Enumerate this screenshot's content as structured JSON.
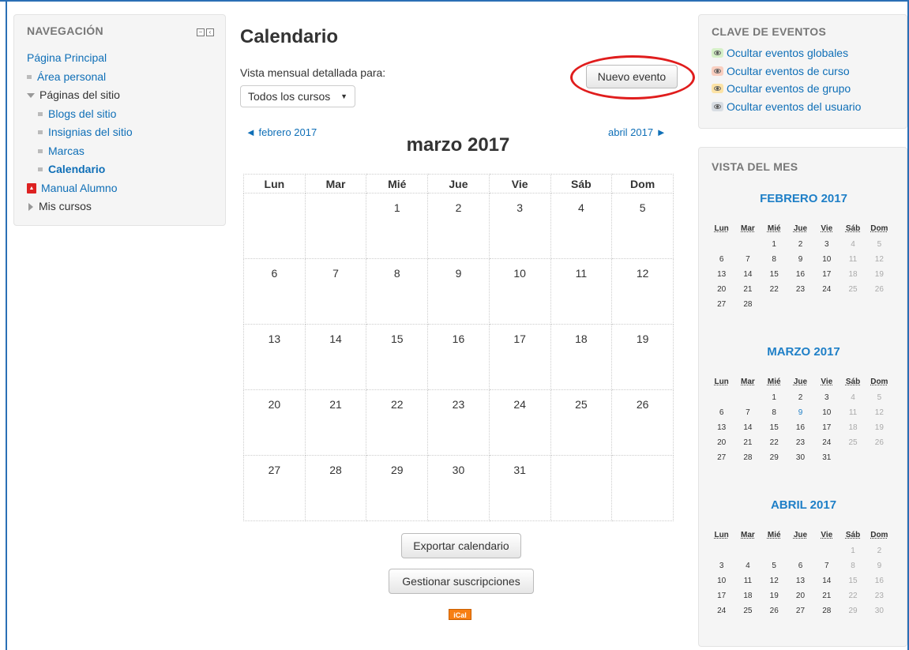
{
  "nav": {
    "title": "NAVEGACIÓN",
    "home": "Página Principal",
    "personal": "Área personal",
    "site_pages": "Páginas del sitio",
    "blogs": "Blogs del sitio",
    "badges": "Insignias del sitio",
    "tags": "Marcas",
    "calendar": "Calendario",
    "manual": "Manual Alumno",
    "my_courses": "Mis cursos"
  },
  "main": {
    "title": "Calendario",
    "view_label": "Vista mensual detallada para:",
    "course_select": "Todos los cursos",
    "new_event": "Nuevo evento",
    "prev_month": "◄ febrero 2017",
    "next_month": "abril 2017 ►",
    "month_title": "marzo 2017",
    "weekdays": [
      "Lun",
      "Mar",
      "Mié",
      "Jue",
      "Vie",
      "Sáb",
      "Dom"
    ],
    "weeks": [
      [
        "",
        "",
        "1",
        "2",
        "3",
        "4",
        "5"
      ],
      [
        "6",
        "7",
        "8",
        "9",
        "10",
        "11",
        "12"
      ],
      [
        "13",
        "14",
        "15",
        "16",
        "17",
        "18",
        "19"
      ],
      [
        "20",
        "21",
        "22",
        "23",
        "24",
        "25",
        "26"
      ],
      [
        "27",
        "28",
        "29",
        "30",
        "31",
        "",
        ""
      ]
    ],
    "export": "Exportar calendario",
    "subscriptions": "Gestionar suscripciones",
    "ical": "iCal"
  },
  "event_key": {
    "title": "CLAVE DE EVENTOS",
    "items": [
      {
        "label": "Ocultar eventos globales",
        "color": "#d6f0c8"
      },
      {
        "label": "Ocultar eventos de curso",
        "color": "#f9cfc0"
      },
      {
        "label": "Ocultar eventos de grupo",
        "color": "#fce3a6"
      },
      {
        "label": "Ocultar eventos del usuario",
        "color": "#d8dde3"
      }
    ]
  },
  "month_view": {
    "title": "VISTA DEL MES",
    "weekdays": [
      "Lun",
      "Mar",
      "Mié",
      "Jue",
      "Vie",
      "Sáb",
      "Dom"
    ],
    "months": [
      {
        "name": "FEBRERO 2017",
        "weeks": [
          [
            "",
            "",
            "1",
            "2",
            "3",
            "4",
            "5"
          ],
          [
            "6",
            "7",
            "8",
            "9",
            "10",
            "11",
            "12"
          ],
          [
            "13",
            "14",
            "15",
            "16",
            "17",
            "18",
            "19"
          ],
          [
            "20",
            "21",
            "22",
            "23",
            "24",
            "25",
            "26"
          ],
          [
            "27",
            "28",
            "",
            "",
            "",
            "",
            ""
          ]
        ]
      },
      {
        "name": "MARZO 2017",
        "weeks": [
          [
            "",
            "",
            "1",
            "2",
            "3",
            "4",
            "5"
          ],
          [
            "6",
            "7",
            "8",
            "9",
            "10",
            "11",
            "12"
          ],
          [
            "13",
            "14",
            "15",
            "16",
            "17",
            "18",
            "19"
          ],
          [
            "20",
            "21",
            "22",
            "23",
            "24",
            "25",
            "26"
          ],
          [
            "27",
            "28",
            "29",
            "30",
            "31",
            "",
            ""
          ]
        ],
        "today": "9"
      },
      {
        "name": "ABRIL 2017",
        "weeks": [
          [
            "",
            "",
            "",
            "",
            "",
            "1",
            "2"
          ],
          [
            "3",
            "4",
            "5",
            "6",
            "7",
            "8",
            "9"
          ],
          [
            "10",
            "11",
            "12",
            "13",
            "14",
            "15",
            "16"
          ],
          [
            "17",
            "18",
            "19",
            "20",
            "21",
            "22",
            "23"
          ],
          [
            "24",
            "25",
            "26",
            "27",
            "28",
            "29",
            "30"
          ]
        ]
      }
    ]
  }
}
